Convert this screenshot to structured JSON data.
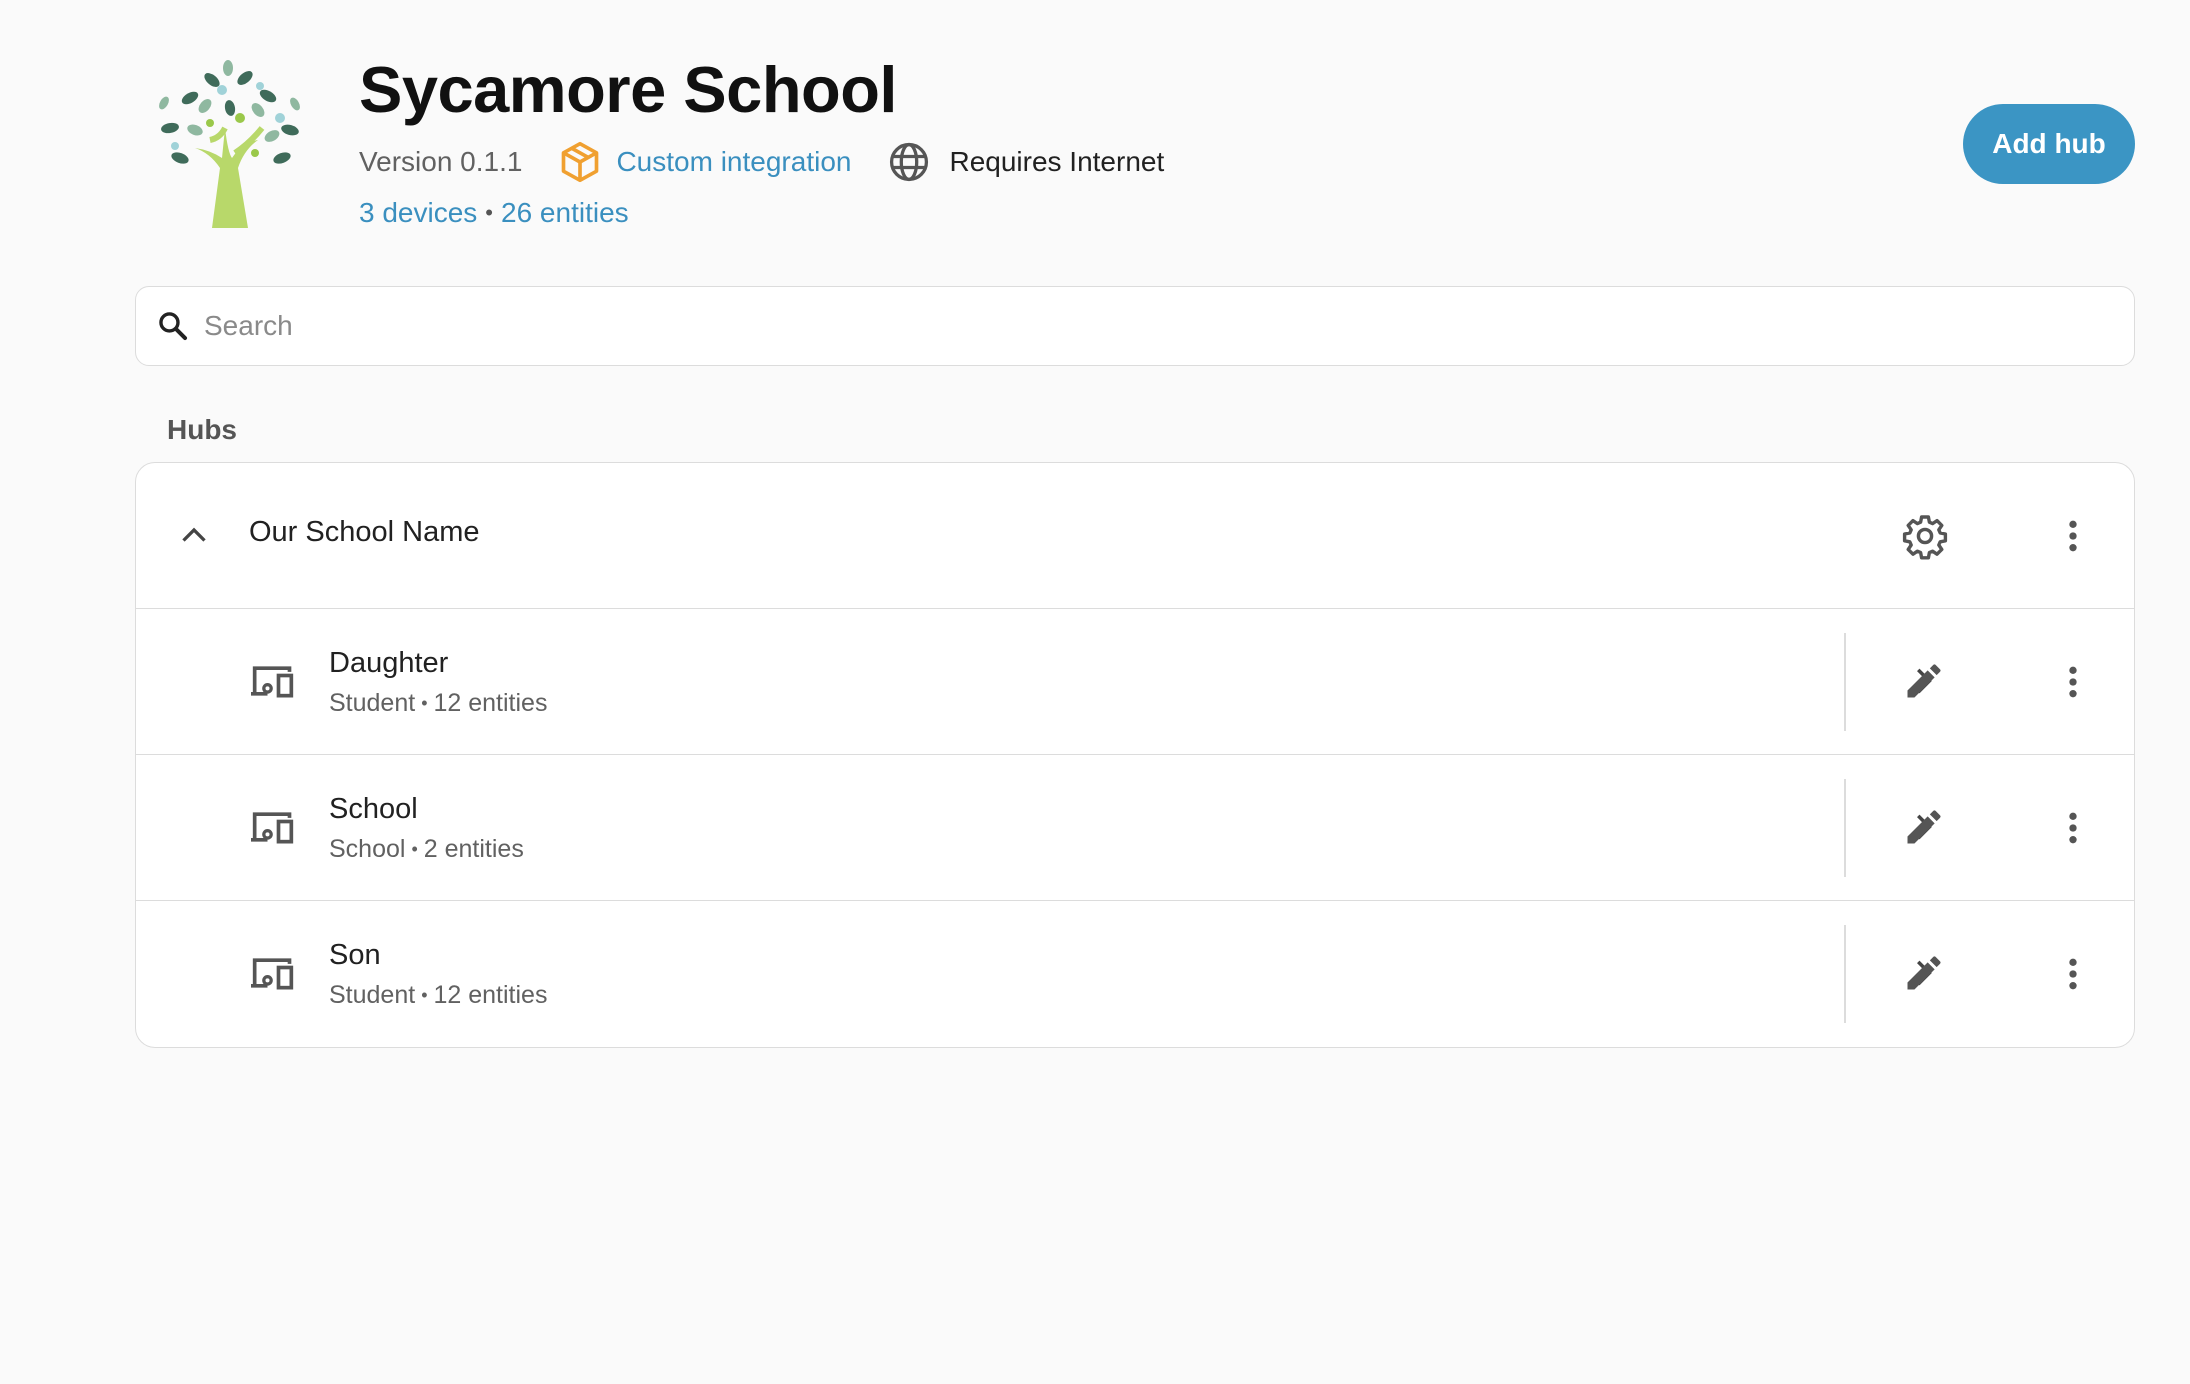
{
  "header": {
    "title": "Sycamore School",
    "version": "Version 0.1.1",
    "custom_integration": "Custom integration",
    "requires_internet": "Requires Internet",
    "devices_link": "3 devices",
    "entities_link": "26 entities",
    "add_button": "Add hub"
  },
  "search": {
    "placeholder": "Search"
  },
  "hubs": {
    "section_label": "Hubs",
    "hub_name": "Our School Name",
    "devices": [
      {
        "name": "Daughter",
        "type": "Student",
        "entities": "12 entities"
      },
      {
        "name": "School",
        "type": "School",
        "entities": "2 entities"
      },
      {
        "name": "Son",
        "type": "Student",
        "entities": "12 entities"
      }
    ]
  },
  "icons": {
    "logo": "tree-logo",
    "custom": "package-icon",
    "globe": "globe-icon",
    "search": "search-icon",
    "collapse": "chevron-up-icon",
    "settings": "gear-icon",
    "menu": "dots-vertical-icon",
    "device": "devices-icon",
    "navigate": "chevron-right-icon",
    "edit": "pencil-icon"
  },
  "colors": {
    "accent": "#3b95c4",
    "link": "#3a8fbf",
    "custom_icon": "#f0a030",
    "background": "#fafafa"
  }
}
